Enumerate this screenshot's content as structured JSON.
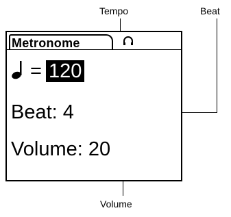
{
  "callouts": {
    "tempo": "Tempo",
    "beat": "Beat",
    "volume": "Volume"
  },
  "tabs": [
    {
      "label": "Metronome",
      "selected": true
    },
    {
      "label": "",
      "icon": "headphone-icon",
      "selected": false
    }
  ],
  "tempo": {
    "icon": "quarter-note-icon",
    "equals": "=",
    "value": "120",
    "highlighted": true
  },
  "beat": {
    "label": "Beat:",
    "value": "4"
  },
  "volume": {
    "label": "Volume:",
    "value": "20"
  },
  "colors": {
    "foreground": "#000000",
    "background": "#ffffff",
    "highlight_text": "#ffffff"
  }
}
